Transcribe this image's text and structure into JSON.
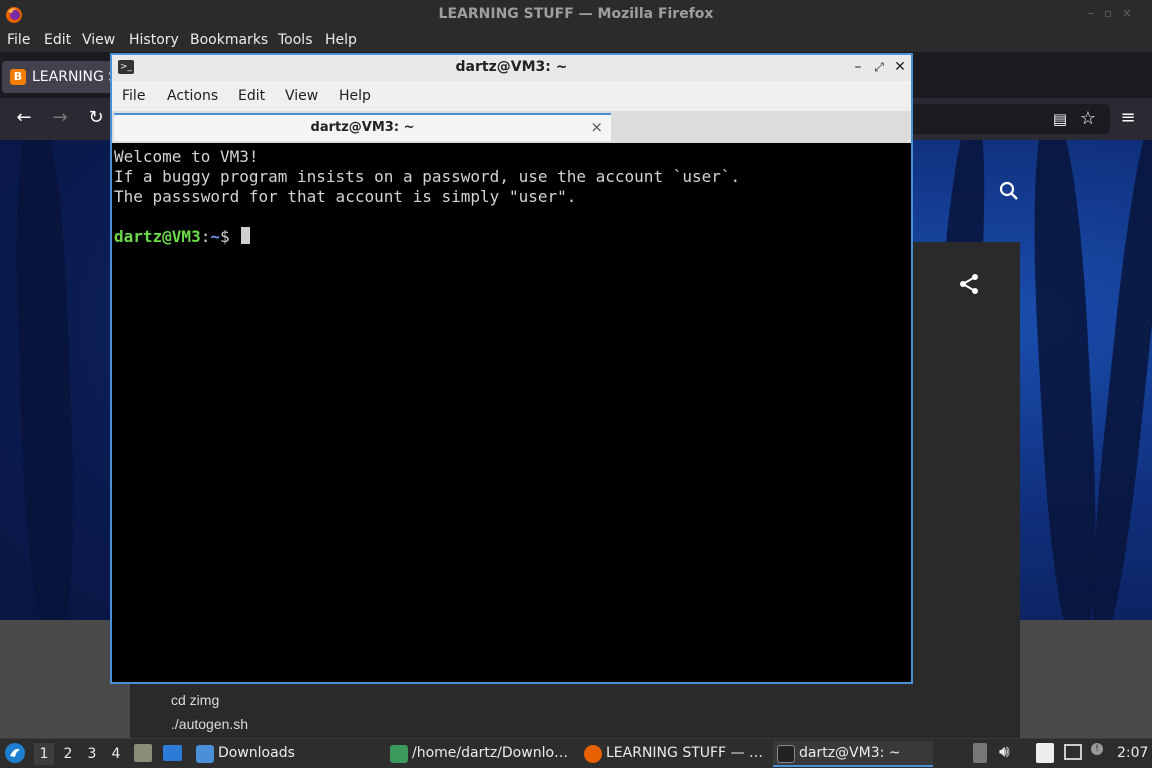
{
  "firefox": {
    "window_title": "LEARNING STUFF — Mozilla Firefox",
    "menu": [
      "File",
      "Edit",
      "View",
      "History",
      "Bookmarks",
      "Tools",
      "Help"
    ],
    "tab_label": "LEARNING S",
    "tab_favicon": "B"
  },
  "page": {
    "code_lines": [
      "cd zimg",
      "./autogen.sh"
    ]
  },
  "terminal": {
    "window_title": "dartz@VM3: ~",
    "menu": [
      "File",
      "Actions",
      "Edit",
      "View",
      "Help"
    ],
    "tab_label": "dartz@VM3: ~",
    "tab_close": "×",
    "output_lines": [
      "Welcome to VM3!",
      "If a buggy program insists on a password, use the account `user`.",
      "The passsword for that account is simply \"user\"."
    ],
    "prompt_user": "dartz@VM3",
    "prompt_sep": ":",
    "prompt_path": "~",
    "prompt_symbol": "$ "
  },
  "taskbar": {
    "workspaces": [
      "1",
      "2",
      "3",
      "4"
    ],
    "tasks": [
      {
        "label": "Downloads",
        "icon": "folder-icon"
      },
      {
        "label": "/home/dartz/Downlo…",
        "icon": "image-viewer-icon"
      },
      {
        "label": "LEARNING STUFF — …",
        "icon": "firefox-icon"
      },
      {
        "label": "dartz@VM3: ~",
        "icon": "terminal-icon"
      }
    ],
    "clock": "2:07"
  },
  "colors": {
    "accent": "#4b8fd6",
    "prompt_user": "#6cdc4a",
    "prompt_path": "#6f8ff0"
  }
}
